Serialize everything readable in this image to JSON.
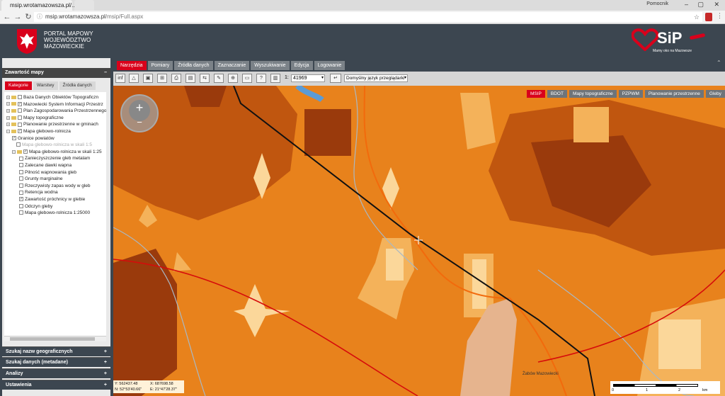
{
  "browser": {
    "tab_title": "msip.wrotamazowsza.pl/...",
    "url_domain": "msip.wrotamazowsza.pl",
    "url_path": "/msip/Full.aspx",
    "window_label": "Pomocnik"
  },
  "header": {
    "portal_title_line1": "PORTAL MAPOWY",
    "portal_title_line2": "WOJEWÓDZTWO",
    "portal_title_line3": "MAZOWIECKIE",
    "logo_text": "SiP",
    "logo_tagline": "Mamy oko na Mazowsze",
    "brand_red": "#d9001b"
  },
  "left_panel": {
    "title": "Zawartość mapy",
    "tabs": [
      "Kategorie",
      "Warstwy",
      "Źródła danych"
    ],
    "active_tab": "Kategorie",
    "tree": [
      {
        "label": "Baza Danych Obiektów Topograficzn",
        "checked": false,
        "expand": "+"
      },
      {
        "label": "Mazowiecki System Informacji Przestrz",
        "checked": true,
        "expand": "+"
      },
      {
        "label": "Plan Zagospodarowania Przestrzennego",
        "checked": false,
        "expand": "+"
      },
      {
        "label": "Mapy topograficzne",
        "checked": false,
        "expand": "+"
      },
      {
        "label": "Planowanie przestrzenne w gminach",
        "checked": false,
        "expand": "+"
      },
      {
        "label": "Mapa glebowo-rolnicza",
        "checked": true,
        "expand": "-"
      },
      {
        "label": "Granice powiatów",
        "checked": true,
        "expand": ""
      },
      {
        "label": "Mapa glebowo-rolnicza w skali 1:5",
        "checked": false,
        "expand": "",
        "greyed": true
      },
      {
        "label": "Mapa glebowo-rolnicza w skali 1:25",
        "checked": true,
        "expand": "-"
      },
      {
        "label": "Zanieczyszczenie gleb metalam",
        "checked": false,
        "expand": ""
      },
      {
        "label": "Zalecane dawki wapna",
        "checked": false,
        "expand": ""
      },
      {
        "label": "Pilność wapnowania gleb",
        "checked": false,
        "expand": ""
      },
      {
        "label": "Grunty marginalne",
        "checked": false,
        "expand": ""
      },
      {
        "label": "Rzeczywisty zapas wody w gleb",
        "checked": false,
        "expand": ""
      },
      {
        "label": "Retencja wodna",
        "checked": false,
        "expand": ""
      },
      {
        "label": "Zawartość próchnicy w glebie",
        "checked": true,
        "expand": ""
      },
      {
        "label": "Odczyn gleby",
        "checked": false,
        "expand": ""
      },
      {
        "label": "Mapa glebowo-rolnicza 1:25000",
        "checked": false,
        "expand": ""
      }
    ],
    "accordions": [
      "Szukaj nazw geograficznych",
      "Szukaj danych (metadane)",
      "Analizy",
      "Ustawienia"
    ]
  },
  "menu": {
    "tabs": [
      "Narzędzia",
      "Pomiary",
      "Źródła danych",
      "Zaznaczanie",
      "Wyszukiwanie",
      "Edycja",
      "Logowanie"
    ],
    "active": "Narzędzia"
  },
  "toolbar": {
    "tools": [
      "info",
      "measure",
      "zoom-box",
      "zoom-in",
      "print",
      "image",
      "export",
      "draw",
      "add-layer",
      "map",
      "help",
      "ruler"
    ],
    "scale_prefix": "1:",
    "scale_value": "41969",
    "background_select": "Domyślny język przeglądarki"
  },
  "map": {
    "layer_buttons": [
      "MSIP",
      "BDOT",
      "Mapy topograficzne",
      "PZPWM",
      "Planowanie przestrzenne",
      "Gleby"
    ],
    "active_layer": "MSIP",
    "town_label": "Żabów Mazowiecki",
    "coords": {
      "y": "Y: 562437.48",
      "x": "X: 687698.58",
      "n": "N: 52°53'40.66\"",
      "e": "E: 21°47'28.37\""
    },
    "scalebar_labels": [
      "0",
      "1",
      "2",
      "km"
    ],
    "colors": {
      "base": "#e8821c",
      "dark": "#c0560f",
      "darker": "#9a3a0c",
      "light": "#f4b25a",
      "lightest": "#fbd79a",
      "urban": "#e6b48e",
      "river": "#a9b8c4",
      "county_border": "#d60b0b",
      "railway": "#111111",
      "road": "#f26a0c"
    }
  }
}
